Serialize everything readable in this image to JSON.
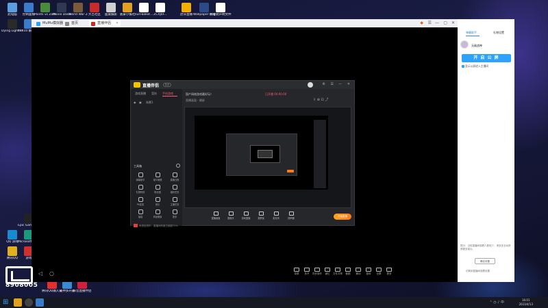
{
  "desktop": {
    "top_row": [
      {
        "label": "此电脑",
        "color": "#5aa0e0"
      },
      {
        "label": "控制面板",
        "color": "#3a7cc9"
      },
      {
        "label": "Points vs Zombie...",
        "color": "#4b8a3a"
      },
      {
        "label": "Movie Dash",
        "color": "#2f3a52"
      },
      {
        "label": "World War Z",
        "color": "#7a5a3a"
      },
      {
        "label": "大吉社区",
        "color": "#c92a2a"
      },
      {
        "label": "面桌摄影",
        "color": "#d0d0d0"
      },
      {
        "label": "富豪小报社",
        "color": "#e0a020"
      },
      {
        "label": "null-ballot...",
        "color": "#ffffff"
      },
      {
        "label": "ZCXJ0F...",
        "color": "#ffffff"
      },
      {
        "label": "虎牙直播",
        "color": "#f4b000"
      },
      {
        "label": "Wallpaper Engine: ...",
        "color": "#2a4a8a"
      },
      {
        "label": "我爆款声明文件夹",
        "color": "#ffffff"
      }
    ],
    "second_row": [
      {
        "label": "Dying Light The Follo...",
        "color": "#2a2a2a"
      },
      {
        "label": "Win10 解码 密码工具",
        "color": "#3a7cc9"
      }
    ],
    "left_column": [
      {
        "label": "Epic Games Launcher",
        "color": "#222222"
      },
      {
        "label": "QQ 游戏",
        "color": "#1a8ad0"
      },
      {
        "label": "Microsoft Edge",
        "color": "#1a9a7a"
      },
      {
        "label": "腾讯QQ",
        "color": "#e0b020"
      },
      {
        "label": "游戏",
        "color": "#d03030"
      }
    ],
    "bottom_row": [
      {
        "label": "腾讯QQ输入法",
        "color": "#e03030"
      },
      {
        "label": "夜神多开器",
        "color": "#3a8ad0"
      },
      {
        "label": "抖音直播伴侣",
        "color": "#d02040"
      }
    ]
  },
  "watermark": {
    "logo_text": "斗鱼",
    "room_number": "8908005"
  },
  "emulator": {
    "tabs": [
      {
        "label": "MuMu模拟器",
        "color": "#2da3ff"
      },
      {
        "label": "首页",
        "color": "#888888"
      },
      {
        "label": "直播伴侣",
        "color": "#c92a2a",
        "active": true
      }
    ],
    "window_controls": [
      "◆",
      "☰",
      "—",
      "▢",
      "✕"
    ],
    "toolbar": [
      "录屏",
      "多开",
      "同步操作",
      "键位",
      "文件共享",
      "截图",
      "震动",
      "旋转",
      "全屏",
      "更多"
    ]
  },
  "app": {
    "name": "直播伴侣",
    "version": "2.0",
    "left_tabs": [
      "游戏直播",
      "竞技",
      "手机游戏"
    ],
    "scene_label": "场景1",
    "tools_title": "工具箱",
    "tools": [
      "弹幕助手",
      "观众管理",
      "直播日报",
      "礼物特效",
      "粉丝团",
      "福利任务",
      "PK连麦",
      "音乐",
      "主播任务",
      "福袋",
      "商品橱窗",
      "更多"
    ],
    "status_text": "系统检测中，直播间热度已超越70%",
    "preview_header": "国产网络游戏最好玩！",
    "preview_header_tag": "已开播 00:00:00",
    "preview_sub": "直播画面 · 横屏",
    "bottom_actions": [
      "直播画面",
      "摄像头",
      "游戏直播",
      "录屏窗",
      "麦克风",
      "扬声器"
    ],
    "go_live_label": "开始直播"
  },
  "right_panel": {
    "tabs": [
      "弹幕助手",
      "礼物设置"
    ],
    "username": "无敌战神",
    "primary_button": "开 启 公 屏",
    "checkbox_label": "显示公屏进入主播间",
    "notice": "提示：当前直播间观看人数较少，请多多互动获得更多观众。",
    "secondary_button": "确定设置",
    "footer": "切换到直播间观看设置"
  },
  "taskbar": {
    "time": "16:01",
    "date": "2023/4/13",
    "apps": [
      {
        "name": "windows",
        "color": "#3aa0ff"
      },
      {
        "name": "search",
        "color": "#555555"
      },
      {
        "name": "file-explorer",
        "color": "#e0a020"
      },
      {
        "name": "browser",
        "color": "#e05a2a"
      },
      {
        "name": "store",
        "color": "#3a7cc9"
      }
    ]
  }
}
